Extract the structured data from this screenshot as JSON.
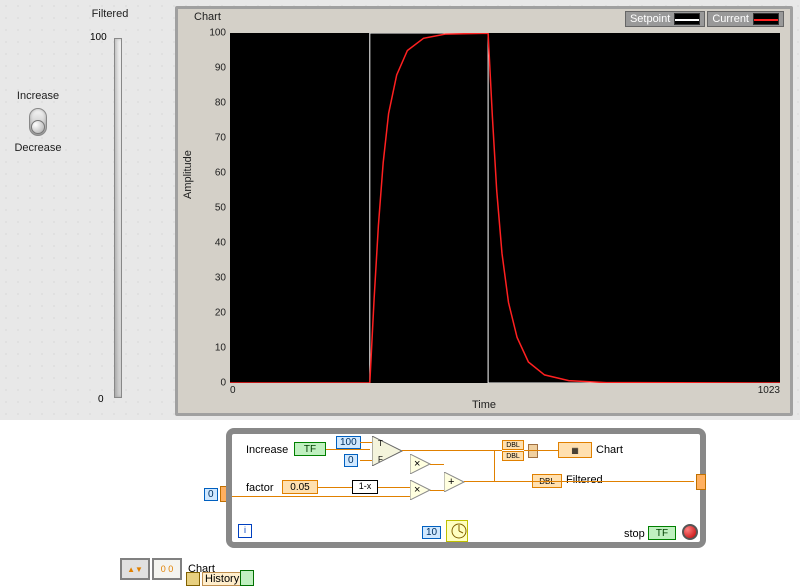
{
  "toggle": {
    "increase_label": "Increase",
    "decrease_label": "Decrease"
  },
  "slider": {
    "title": "Filtered",
    "max": "100",
    "min": "0"
  },
  "chart": {
    "title": "Chart",
    "ylabel": "Amplitude",
    "xlabel": "Time",
    "x_ticks": [
      "0",
      "1023"
    ],
    "y_ticks": [
      "0",
      "10",
      "20",
      "30",
      "40",
      "50",
      "60",
      "70",
      "80",
      "90",
      "100"
    ],
    "legend": [
      {
        "name": "Setpoint",
        "color": "#ffffff"
      },
      {
        "name": "Current",
        "color": "#ff2020"
      }
    ]
  },
  "chart_data": {
    "type": "line",
    "title": "Chart",
    "xlabel": "Time",
    "ylabel": "Amplitude",
    "xlim": [
      0,
      1023
    ],
    "ylim": [
      0,
      100
    ],
    "series": [
      {
        "name": "Setpoint",
        "color": "#ffffff",
        "x": [
          0,
          260,
          260,
          480,
          480,
          1023
        ],
        "y": [
          0,
          0,
          100,
          100,
          0,
          0
        ]
      },
      {
        "name": "Current",
        "color": "#ff2020",
        "x": [
          0,
          260,
          268,
          276,
          285,
          295,
          310,
          330,
          360,
          400,
          480,
          488,
          496,
          506,
          518,
          534,
          555,
          585,
          630,
          700,
          1023
        ],
        "y": [
          0,
          0,
          24,
          45,
          63,
          77,
          88,
          95,
          98.5,
          99.7,
          99.9,
          76,
          55,
          37,
          23,
          13,
          6,
          2.3,
          0.7,
          0.1,
          0
        ]
      }
    ]
  },
  "diagram": {
    "increase_label": "Increase",
    "tf_label": "TF",
    "const_100": "100",
    "const_0": "0",
    "factor_label": "factor",
    "factor_value": "0.05",
    "one_minus_x": "1-x",
    "chart_label": "Chart",
    "filtered_label": "Filtered",
    "outer_zero": "0",
    "iter_i": "i",
    "delay_ms": "10",
    "stop_label": "stop",
    "history_label": "History",
    "history_idx": "0",
    "history_val": "0",
    "dbl": "DBL"
  }
}
